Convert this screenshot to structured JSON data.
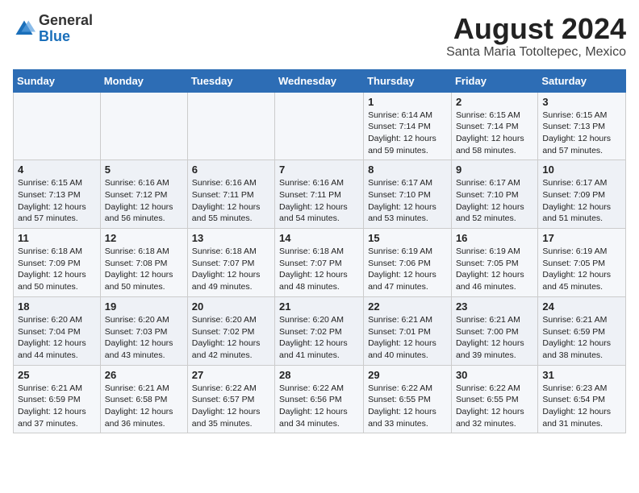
{
  "header": {
    "logo_general": "General",
    "logo_blue": "Blue",
    "month_year": "August 2024",
    "location": "Santa Maria Totoltepec, Mexico"
  },
  "days_of_week": [
    "Sunday",
    "Monday",
    "Tuesday",
    "Wednesday",
    "Thursday",
    "Friday",
    "Saturday"
  ],
  "weeks": [
    [
      {
        "day": "",
        "content": ""
      },
      {
        "day": "",
        "content": ""
      },
      {
        "day": "",
        "content": ""
      },
      {
        "day": "",
        "content": ""
      },
      {
        "day": "1",
        "content": "Sunrise: 6:14 AM\nSunset: 7:14 PM\nDaylight: 12 hours\nand 59 minutes."
      },
      {
        "day": "2",
        "content": "Sunrise: 6:15 AM\nSunset: 7:14 PM\nDaylight: 12 hours\nand 58 minutes."
      },
      {
        "day": "3",
        "content": "Sunrise: 6:15 AM\nSunset: 7:13 PM\nDaylight: 12 hours\nand 57 minutes."
      }
    ],
    [
      {
        "day": "4",
        "content": "Sunrise: 6:15 AM\nSunset: 7:13 PM\nDaylight: 12 hours\nand 57 minutes."
      },
      {
        "day": "5",
        "content": "Sunrise: 6:16 AM\nSunset: 7:12 PM\nDaylight: 12 hours\nand 56 minutes."
      },
      {
        "day": "6",
        "content": "Sunrise: 6:16 AM\nSunset: 7:11 PM\nDaylight: 12 hours\nand 55 minutes."
      },
      {
        "day": "7",
        "content": "Sunrise: 6:16 AM\nSunset: 7:11 PM\nDaylight: 12 hours\nand 54 minutes."
      },
      {
        "day": "8",
        "content": "Sunrise: 6:17 AM\nSunset: 7:10 PM\nDaylight: 12 hours\nand 53 minutes."
      },
      {
        "day": "9",
        "content": "Sunrise: 6:17 AM\nSunset: 7:10 PM\nDaylight: 12 hours\nand 52 minutes."
      },
      {
        "day": "10",
        "content": "Sunrise: 6:17 AM\nSunset: 7:09 PM\nDaylight: 12 hours\nand 51 minutes."
      }
    ],
    [
      {
        "day": "11",
        "content": "Sunrise: 6:18 AM\nSunset: 7:09 PM\nDaylight: 12 hours\nand 50 minutes."
      },
      {
        "day": "12",
        "content": "Sunrise: 6:18 AM\nSunset: 7:08 PM\nDaylight: 12 hours\nand 50 minutes."
      },
      {
        "day": "13",
        "content": "Sunrise: 6:18 AM\nSunset: 7:07 PM\nDaylight: 12 hours\nand 49 minutes."
      },
      {
        "day": "14",
        "content": "Sunrise: 6:18 AM\nSunset: 7:07 PM\nDaylight: 12 hours\nand 48 minutes."
      },
      {
        "day": "15",
        "content": "Sunrise: 6:19 AM\nSunset: 7:06 PM\nDaylight: 12 hours\nand 47 minutes."
      },
      {
        "day": "16",
        "content": "Sunrise: 6:19 AM\nSunset: 7:05 PM\nDaylight: 12 hours\nand 46 minutes."
      },
      {
        "day": "17",
        "content": "Sunrise: 6:19 AM\nSunset: 7:05 PM\nDaylight: 12 hours\nand 45 minutes."
      }
    ],
    [
      {
        "day": "18",
        "content": "Sunrise: 6:20 AM\nSunset: 7:04 PM\nDaylight: 12 hours\nand 44 minutes."
      },
      {
        "day": "19",
        "content": "Sunrise: 6:20 AM\nSunset: 7:03 PM\nDaylight: 12 hours\nand 43 minutes."
      },
      {
        "day": "20",
        "content": "Sunrise: 6:20 AM\nSunset: 7:02 PM\nDaylight: 12 hours\nand 42 minutes."
      },
      {
        "day": "21",
        "content": "Sunrise: 6:20 AM\nSunset: 7:02 PM\nDaylight: 12 hours\nand 41 minutes."
      },
      {
        "day": "22",
        "content": "Sunrise: 6:21 AM\nSunset: 7:01 PM\nDaylight: 12 hours\nand 40 minutes."
      },
      {
        "day": "23",
        "content": "Sunrise: 6:21 AM\nSunset: 7:00 PM\nDaylight: 12 hours\nand 39 minutes."
      },
      {
        "day": "24",
        "content": "Sunrise: 6:21 AM\nSunset: 6:59 PM\nDaylight: 12 hours\nand 38 minutes."
      }
    ],
    [
      {
        "day": "25",
        "content": "Sunrise: 6:21 AM\nSunset: 6:59 PM\nDaylight: 12 hours\nand 37 minutes."
      },
      {
        "day": "26",
        "content": "Sunrise: 6:21 AM\nSunset: 6:58 PM\nDaylight: 12 hours\nand 36 minutes."
      },
      {
        "day": "27",
        "content": "Sunrise: 6:22 AM\nSunset: 6:57 PM\nDaylight: 12 hours\nand 35 minutes."
      },
      {
        "day": "28",
        "content": "Sunrise: 6:22 AM\nSunset: 6:56 PM\nDaylight: 12 hours\nand 34 minutes."
      },
      {
        "day": "29",
        "content": "Sunrise: 6:22 AM\nSunset: 6:55 PM\nDaylight: 12 hours\nand 33 minutes."
      },
      {
        "day": "30",
        "content": "Sunrise: 6:22 AM\nSunset: 6:55 PM\nDaylight: 12 hours\nand 32 minutes."
      },
      {
        "day": "31",
        "content": "Sunrise: 6:23 AM\nSunset: 6:54 PM\nDaylight: 12 hours\nand 31 minutes."
      }
    ]
  ]
}
